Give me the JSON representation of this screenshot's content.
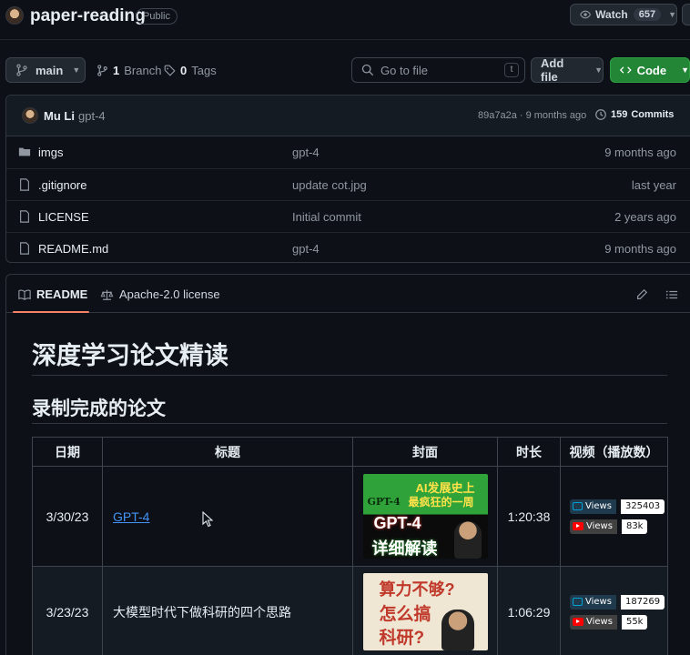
{
  "header": {
    "repo_name": "paper-reading",
    "visibility": "Public",
    "watch_label": "Watch",
    "watch_count": "657"
  },
  "branch_bar": {
    "branch": "main",
    "branch_count": "1",
    "branch_word": "Branch",
    "tag_count": "0",
    "tag_word": "Tags",
    "search_placeholder": "Go to file",
    "search_shortcut": "t",
    "add_file_label": "Add file",
    "code_label": "Code"
  },
  "latest_commit": {
    "author": "Mu Li",
    "message": "gpt-4",
    "hash_and_time": "89a7a2a · 9 months ago",
    "commits_count": "159",
    "commits_word": "Commits"
  },
  "files": [
    {
      "name": "imgs",
      "type": "folder",
      "message": "gpt-4",
      "date": "9 months ago"
    },
    {
      "name": ".gitignore",
      "type": "file",
      "message": "update cot.jpg",
      "date": "last year"
    },
    {
      "name": "LICENSE",
      "type": "file",
      "message": "Initial commit",
      "date": "2 years ago"
    },
    {
      "name": "README.md",
      "type": "file",
      "message": "gpt-4",
      "date": "9 months ago"
    }
  ],
  "readme": {
    "tab_readme": "README",
    "tab_license": "Apache-2.0 license",
    "title": "深度学习论文精读",
    "subtitle": "录制完成的论文",
    "table": {
      "headers": [
        "日期",
        "标题",
        "封面",
        "时长",
        "视频（播放数）"
      ],
      "rows": [
        {
          "date": "3/30/23",
          "title": "GPT-4",
          "cover_lines": [
            "GPT-4",
            "AI发展史上",
            "最疯狂的一周",
            "GPT-4",
            "详细解读"
          ],
          "duration": "1:20:38",
          "bili_label": "Views",
          "bili_count": "325403",
          "yt_label": "Views",
          "yt_count": "83k"
        },
        {
          "date": "3/23/23",
          "title": "大模型时代下做科研的四个思路",
          "cover_lines": [
            "算力不够?",
            "怎么搞",
            "科研?"
          ],
          "duration": "1:06:29",
          "bili_label": "Views",
          "bili_count": "187269",
          "yt_label": "Views",
          "yt_count": "55k"
        }
      ]
    }
  },
  "colors": {
    "background": "#0d1117",
    "border": "#30363d",
    "accent_green": "#238636",
    "link_blue": "#4493f8",
    "tab_underline": "#f78166",
    "youtube_red": "#ff0000",
    "bilibili_blue": "#00a1d6"
  }
}
